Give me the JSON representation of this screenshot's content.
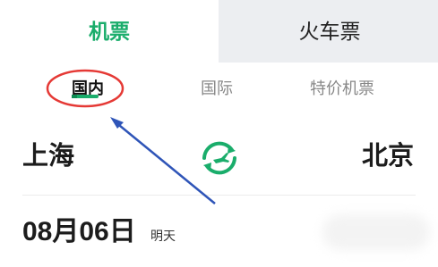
{
  "main_tabs": {
    "flights": "机票",
    "trains": "火车票"
  },
  "sub_tabs": {
    "domestic": "国内",
    "international": "国际",
    "special": "特价机票"
  },
  "route": {
    "from_city": "上海",
    "to_city": "北京",
    "swap_icon": "swap-plane-icon"
  },
  "date": {
    "value": "08月06日",
    "hint": "明天"
  },
  "colors": {
    "accent": "#1aad6b",
    "annotation_red": "#e53935",
    "annotation_blue": "#2f55b8"
  }
}
